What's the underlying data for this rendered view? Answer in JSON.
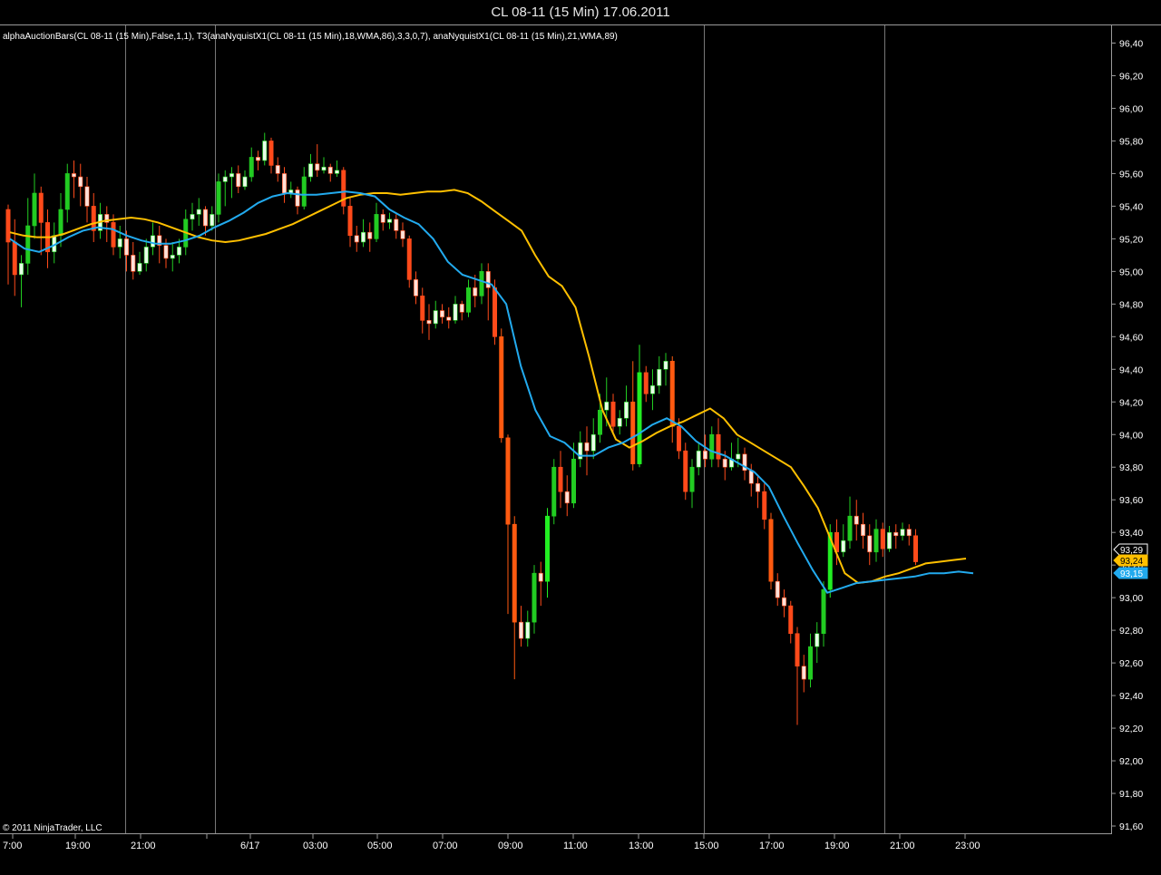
{
  "window": {
    "title": "CL 08-11 (15 Min)  17.06.2011"
  },
  "indicator_label": "alphaAuctionBars(CL 08-11 (15 Min),False,1,1), T3(anaNyquistX1(CL 08-11 (15 Min),18,WMA,86),3,3,0,7), anaNyquistX1(CL 08-11 (15 Min),21,WMA,89)",
  "copyright": "© 2011 NinjaTrader, LLC",
  "colors": {
    "background": "#000000",
    "up_candle": "#22cc22",
    "down_candle": "#ff4a1a",
    "up_bright": "#22ee22",
    "down_bright": "#ff5a10",
    "neutral_candle": "#ffffff",
    "t3_line": "#ffc000",
    "nyquist_line": "#22aaee",
    "axis": "#9a9a9a",
    "session_line": "#777777"
  },
  "chart_data": {
    "type": "candlestick",
    "title": "CL 08-11 (15 Min)  17.06.2011",
    "y_axis": {
      "min": 91.6,
      "max": 96.4,
      "ticks": [
        "96,40",
        "96,20",
        "96,00",
        "95,80",
        "95,60",
        "95,40",
        "95,20",
        "95,00",
        "94,80",
        "94,60",
        "94,40",
        "94,20",
        "94,00",
        "93,80",
        "93,60",
        "93,40",
        "93,20",
        "93,00",
        "92,80",
        "92,60",
        "92,40",
        "92,20",
        "92,00",
        "91,80",
        "91,60"
      ],
      "position": "right",
      "grid": false
    },
    "x_axis": {
      "tick_labels": [
        "7:00",
        "19:00",
        "21:00",
        "6/17",
        "03:00",
        "05:00",
        "07:00",
        "09:00",
        "11:00",
        "13:00",
        "15:00",
        "17:00",
        "19:00",
        "21:00",
        "23:00"
      ],
      "session_breaks": [
        "20:30",
        "23:15",
        "14:45",
        "20:15"
      ]
    },
    "last_values": [
      {
        "name": "Close",
        "value": "93,29",
        "color": "#000000",
        "border": "#ffffff",
        "text_color": "#ffffff"
      },
      {
        "name": "T3",
        "value": "93,24",
        "color": "#ffc000",
        "border": "#ffc000",
        "text_color": "#000000"
      },
      {
        "name": "anaNyquistX1",
        "value": "93,15",
        "color": "#22aaee",
        "border": "#22aaee",
        "text_color": "#ffffff"
      }
    ],
    "candles": [
      [
        95.38,
        95.18,
        95.41,
        94.92
      ],
      [
        95.18,
        94.98,
        95.32,
        94.85
      ],
      [
        94.98,
        95.05,
        95.1,
        94.78
      ],
      [
        95.05,
        95.28,
        95.45,
        94.98
      ],
      [
        95.28,
        95.48,
        95.6,
        95.2
      ],
      [
        95.48,
        95.3,
        95.52,
        95.1
      ],
      [
        95.3,
        95.12,
        95.38,
        95.02
      ],
      [
        95.12,
        95.22,
        95.3,
        95.05
      ],
      [
        95.22,
        95.38,
        95.48,
        95.15
      ],
      [
        95.38,
        95.6,
        95.66,
        95.3
      ],
      [
        95.6,
        95.58,
        95.68,
        95.45
      ],
      [
        95.58,
        95.52,
        95.66,
        95.4
      ],
      [
        95.52,
        95.4,
        95.58,
        95.3
      ],
      [
        95.4,
        95.25,
        95.48,
        95.18
      ],
      [
        95.25,
        95.35,
        95.42,
        95.2
      ],
      [
        95.35,
        95.3,
        95.4,
        95.18
      ],
      [
        95.3,
        95.15,
        95.35,
        95.1
      ],
      [
        95.15,
        95.2,
        95.28,
        95.08
      ],
      [
        95.2,
        95.1,
        95.25,
        95.0
      ],
      [
        95.1,
        95.0,
        95.18,
        94.95
      ],
      [
        95.0,
        95.05,
        95.12,
        94.98
      ],
      [
        95.05,
        95.15,
        95.2,
        95.0
      ],
      [
        95.15,
        95.22,
        95.3,
        95.1
      ],
      [
        95.22,
        95.16,
        95.28,
        95.05
      ],
      [
        95.16,
        95.08,
        95.2,
        95.02
      ],
      [
        95.08,
        95.1,
        95.18,
        95.0
      ],
      [
        95.1,
        95.15,
        95.2,
        95.05
      ],
      [
        95.15,
        95.32,
        95.38,
        95.1
      ],
      [
        95.32,
        95.35,
        95.42,
        95.25
      ],
      [
        95.35,
        95.38,
        95.45,
        95.28
      ],
      [
        95.38,
        95.28,
        95.4,
        95.22
      ],
      [
        95.28,
        95.35,
        95.4,
        95.25
      ],
      [
        95.35,
        95.55,
        95.6,
        95.3
      ],
      [
        95.55,
        95.58,
        95.62,
        95.4
      ],
      [
        95.58,
        95.6,
        95.64,
        95.45
      ],
      [
        95.6,
        95.52,
        95.65,
        95.48
      ],
      [
        95.52,
        95.58,
        95.62,
        95.5
      ],
      [
        95.58,
        95.7,
        95.76,
        95.55
      ],
      [
        95.7,
        95.68,
        95.74,
        95.62
      ],
      [
        95.68,
        95.8,
        95.85,
        95.65
      ],
      [
        95.8,
        95.65,
        95.82,
        95.6
      ],
      [
        95.65,
        95.6,
        95.7,
        95.55
      ],
      [
        95.6,
        95.48,
        95.64,
        95.42
      ],
      [
        95.48,
        95.5,
        95.55,
        95.45
      ],
      [
        95.5,
        95.4,
        95.52,
        95.35
      ],
      [
        95.4,
        95.58,
        95.64,
        95.38
      ],
      [
        95.58,
        95.66,
        95.72,
        95.55
      ],
      [
        95.66,
        95.62,
        95.78,
        95.58
      ],
      [
        95.62,
        95.64,
        95.7,
        95.6
      ],
      [
        95.64,
        95.6,
        95.66,
        95.55
      ],
      [
        95.6,
        95.62,
        95.68,
        95.58
      ],
      [
        95.62,
        95.4,
        95.64,
        95.35
      ],
      [
        95.4,
        95.22,
        95.45,
        95.15
      ],
      [
        95.22,
        95.18,
        95.28,
        95.12
      ],
      [
        95.18,
        95.24,
        95.32,
        95.15
      ],
      [
        95.24,
        95.2,
        95.3,
        95.12
      ],
      [
        95.2,
        95.35,
        95.42,
        95.18
      ],
      [
        95.35,
        95.3,
        95.38,
        95.25
      ],
      [
        95.3,
        95.32,
        95.36,
        95.26
      ],
      [
        95.32,
        95.25,
        95.35,
        95.2
      ],
      [
        95.25,
        95.2,
        95.3,
        95.15
      ],
      [
        95.2,
        94.95,
        95.22,
        94.9
      ],
      [
        94.95,
        94.85,
        95.0,
        94.8
      ],
      [
        94.85,
        94.7,
        94.9,
        94.62
      ],
      [
        94.7,
        94.68,
        94.8,
        94.58
      ],
      [
        94.68,
        94.76,
        94.82,
        94.65
      ],
      [
        94.76,
        94.72,
        94.8,
        94.68
      ],
      [
        94.72,
        94.7,
        94.78,
        94.65
      ],
      [
        94.7,
        94.8,
        94.85,
        94.68
      ],
      [
        94.8,
        94.75,
        94.82,
        94.7
      ],
      [
        94.75,
        94.9,
        94.95,
        94.72
      ],
      [
        94.9,
        94.85,
        94.98,
        94.78
      ],
      [
        94.85,
        95.0,
        95.05,
        94.8
      ],
      [
        95.0,
        94.9,
        95.05,
        94.7
      ],
      [
        94.9,
        94.6,
        94.95,
        94.55
      ],
      [
        94.6,
        93.98,
        94.65,
        93.95
      ],
      [
        93.98,
        93.45,
        94.0,
        92.9
      ],
      [
        93.45,
        92.85,
        93.5,
        92.5
      ],
      [
        92.85,
        92.75,
        92.95,
        92.7
      ],
      [
        92.75,
        92.85,
        92.92,
        92.7
      ],
      [
        92.85,
        93.15,
        93.2,
        92.78
      ],
      [
        93.15,
        93.1,
        93.22,
        92.95
      ],
      [
        93.1,
        93.5,
        93.55,
        93.0
      ],
      [
        93.5,
        93.8,
        93.85,
        93.45
      ],
      [
        93.8,
        93.65,
        93.9,
        93.55
      ],
      [
        93.65,
        93.58,
        93.75,
        93.5
      ],
      [
        93.58,
        93.85,
        93.95,
        93.55
      ],
      [
        93.85,
        93.95,
        94.02,
        93.8
      ],
      [
        93.95,
        93.9,
        94.05,
        93.75
      ],
      [
        93.9,
        94.0,
        94.1,
        93.85
      ],
      [
        94.0,
        94.15,
        94.25,
        93.95
      ],
      [
        94.15,
        94.2,
        94.35,
        94.05
      ],
      [
        94.2,
        94.05,
        94.25,
        94.0
      ],
      [
        94.05,
        94.1,
        94.15,
        94.0
      ],
      [
        94.1,
        94.2,
        94.3,
        94.05
      ],
      [
        94.2,
        93.82,
        94.45,
        93.78
      ],
      [
        93.82,
        94.38,
        94.55,
        93.8
      ],
      [
        94.38,
        94.25,
        94.42,
        94.2
      ],
      [
        94.25,
        94.3,
        94.4,
        94.15
      ],
      [
        94.3,
        94.4,
        94.48,
        94.25
      ],
      [
        94.4,
        94.45,
        94.5,
        94.3
      ],
      [
        94.45,
        94.05,
        94.48,
        93.95
      ],
      [
        94.05,
        93.9,
        94.1,
        93.85
      ],
      [
        93.9,
        93.65,
        93.95,
        93.6
      ],
      [
        93.65,
        93.8,
        93.85,
        93.55
      ],
      [
        93.8,
        93.9,
        93.95,
        93.75
      ],
      [
        93.9,
        93.85,
        94.0,
        93.8
      ],
      [
        93.85,
        94.0,
        94.05,
        93.8
      ],
      [
        94.0,
        93.85,
        94.1,
        93.8
      ],
      [
        93.85,
        93.8,
        93.9,
        93.72
      ],
      [
        93.8,
        93.85,
        93.95,
        93.78
      ],
      [
        93.85,
        93.88,
        93.98,
        93.8
      ],
      [
        93.88,
        93.78,
        93.92,
        93.72
      ],
      [
        93.78,
        93.7,
        93.82,
        93.62
      ],
      [
        93.7,
        93.65,
        93.75,
        93.55
      ],
      [
        93.65,
        93.48,
        93.7,
        93.42
      ],
      [
        93.48,
        93.1,
        93.52,
        93.05
      ],
      [
        93.1,
        93.0,
        93.15,
        92.95
      ],
      [
        93.0,
        92.95,
        93.05,
        92.88
      ],
      [
        92.95,
        92.78,
        92.98,
        92.72
      ],
      [
        92.78,
        92.58,
        92.82,
        92.22
      ],
      [
        92.58,
        92.5,
        92.65,
        92.42
      ],
      [
        92.5,
        92.7,
        92.78,
        92.45
      ],
      [
        92.7,
        92.78,
        92.85,
        92.6
      ],
      [
        92.78,
        93.05,
        93.1,
        92.7
      ],
      [
        93.05,
        93.4,
        93.45,
        93.0
      ],
      [
        93.4,
        93.28,
        93.48,
        93.2
      ],
      [
        93.28,
        93.35,
        93.45,
        93.25
      ],
      [
        93.35,
        93.5,
        93.62,
        93.3
      ],
      [
        93.5,
        93.45,
        93.6,
        93.35
      ],
      [
        93.45,
        93.38,
        93.52,
        93.3
      ],
      [
        93.38,
        93.28,
        93.45,
        93.2
      ],
      [
        93.28,
        93.42,
        93.48,
        93.22
      ],
      [
        93.42,
        93.3,
        93.46,
        93.25
      ],
      [
        93.3,
        93.4,
        93.44,
        93.28
      ],
      [
        93.4,
        93.38,
        93.45,
        93.3
      ],
      [
        93.38,
        93.42,
        93.46,
        93.35
      ],
      [
        93.42,
        93.38,
        93.45,
        93.32
      ],
      [
        93.38,
        93.22,
        93.42,
        93.2
      ]
    ],
    "series": [
      {
        "name": "T3",
        "values": [
          95.24,
          95.22,
          95.21,
          95.21,
          95.23,
          95.26,
          95.29,
          95.31,
          95.32,
          95.33,
          95.32,
          95.3,
          95.27,
          95.24,
          95.21,
          95.19,
          95.18,
          95.19,
          95.21,
          95.23,
          95.26,
          95.29,
          95.33,
          95.37,
          95.41,
          95.45,
          95.47,
          95.48,
          95.48,
          95.47,
          95.48,
          95.49,
          95.49,
          95.5,
          95.48,
          95.43,
          95.37,
          95.31,
          95.25,
          95.1,
          94.97,
          94.91,
          94.78,
          94.48,
          94.15,
          93.97,
          93.92,
          93.96,
          94.01,
          94.05,
          94.08,
          94.12,
          94.16,
          94.1,
          94.0,
          93.95,
          93.9,
          93.85,
          93.8,
          93.68,
          93.55,
          93.35,
          93.15,
          93.09,
          93.1,
          93.13,
          93.15,
          93.18,
          93.21,
          93.22,
          93.23,
          93.24
        ]
      },
      {
        "name": "anaNyquistX1",
        "values": [
          95.2,
          95.14,
          95.12,
          95.16,
          95.21,
          95.25,
          95.27,
          95.26,
          95.22,
          95.19,
          95.17,
          95.17,
          95.19,
          95.22,
          95.27,
          95.31,
          95.36,
          95.42,
          95.46,
          95.48,
          95.47,
          95.47,
          95.48,
          95.49,
          95.48,
          95.46,
          95.38,
          95.33,
          95.29,
          95.2,
          95.06,
          94.98,
          94.95,
          94.92,
          94.8,
          94.42,
          94.15,
          93.99,
          93.95,
          93.87,
          93.87,
          93.92,
          93.95,
          94.0,
          94.06,
          94.1,
          94.05,
          93.96,
          93.9,
          93.87,
          93.82,
          93.77,
          93.68,
          93.5,
          93.33,
          93.17,
          93.03,
          93.06,
          93.09,
          93.1,
          93.11,
          93.12,
          93.13,
          93.15,
          93.15,
          93.16,
          93.15
        ]
      }
    ]
  }
}
